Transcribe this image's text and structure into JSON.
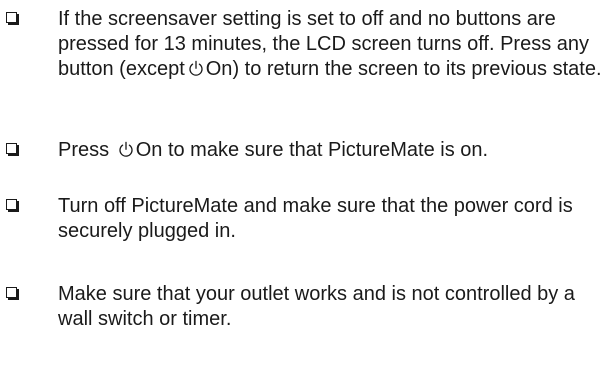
{
  "items": [
    {
      "text_before": "If the screensaver setting is set to off and no buttons are pressed for 13 minutes, the LCD screen turns off. Press any button (except",
      "button_label": "On",
      "text_after": ") to return the screen to its previous state."
    },
    {
      "text_before": "Press",
      "button_label": "On",
      "text_after": "to make sure that PictureMate is on."
    },
    {
      "text": "Turn off PictureMate and make sure that the power cord is securely plugged in."
    },
    {
      "text": "Make sure that your outlet works and is not controlled by a wall switch or timer."
    }
  ],
  "icons": {
    "checkbox": "checkbox-icon",
    "power": "power-icon"
  }
}
